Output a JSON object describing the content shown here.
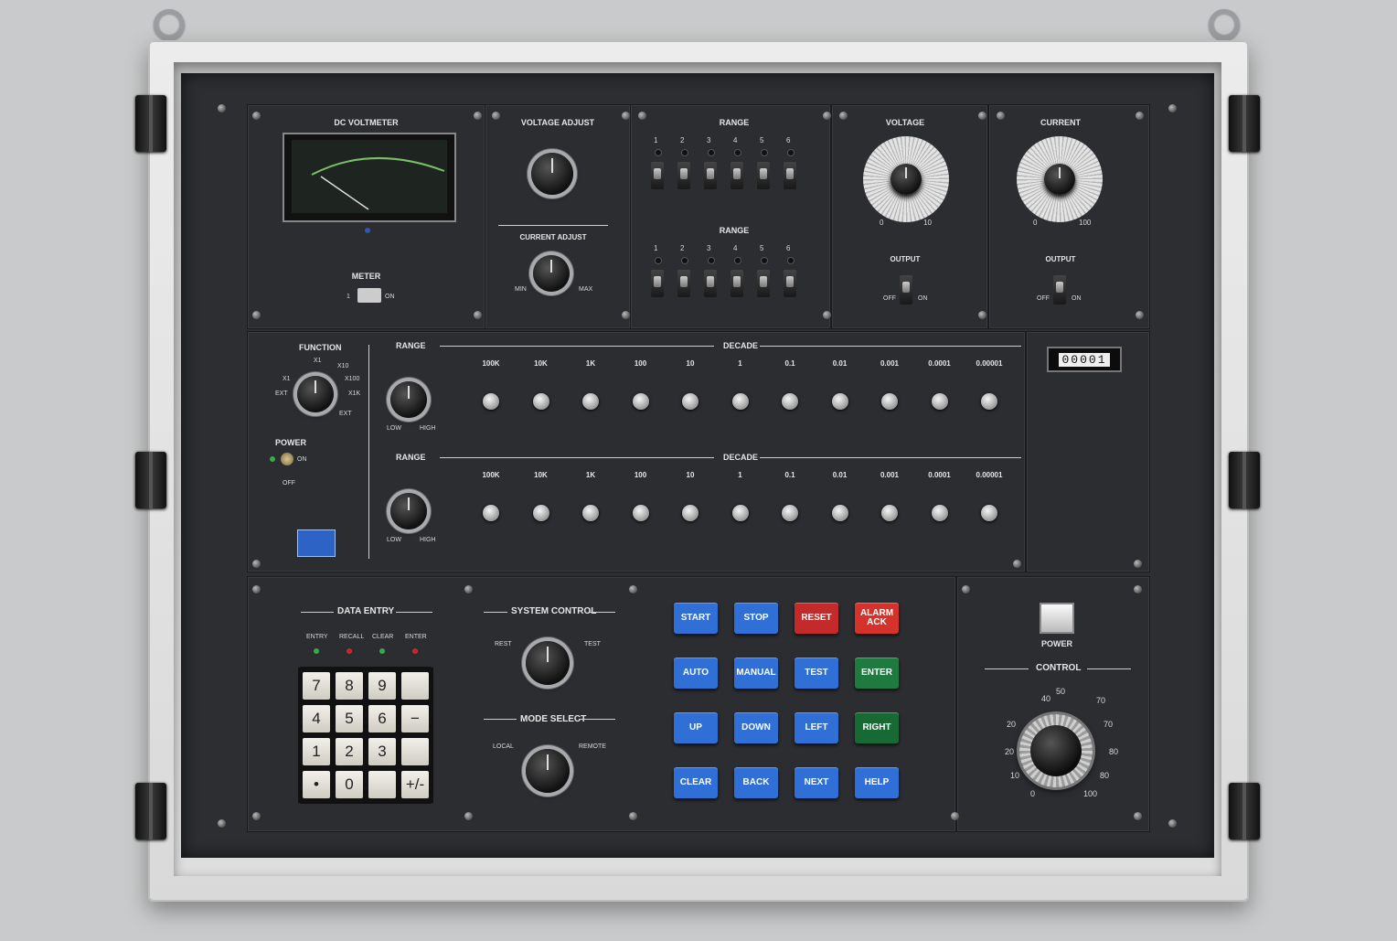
{
  "meter_panel": {
    "title": "DC VOLTMETER",
    "meter_label": "METER",
    "left": "1",
    "right": "ON"
  },
  "adjust_panel": {
    "voltage": "VOLTAGE ADJUST",
    "current": "CURRENT ADJUST",
    "min": "MIN",
    "max": "MAX"
  },
  "range_panel": {
    "title": "RANGE",
    "title2": "RANGE",
    "numbers": [
      "1",
      "2",
      "3",
      "4",
      "5",
      "6"
    ]
  },
  "voltage_panel": {
    "title": "VOLTAGE",
    "min": "0",
    "max": "10",
    "output": "OUTPUT",
    "off": "OFF",
    "on": "ON"
  },
  "current_panel": {
    "title": "CURRENT",
    "min": "0",
    "max": "100",
    "output": "OUTPUT",
    "off": "OFF",
    "on": "ON"
  },
  "function_panel": {
    "function": "FUNCTION",
    "positions": [
      "X1",
      "X1",
      "X10",
      "X100",
      "X1K",
      "EXT",
      "EXT"
    ],
    "power": "POWER",
    "on": "ON",
    "off": "OFF",
    "range": "RANGE",
    "decade": "DECADE",
    "low": "LOW",
    "high": "HIGH",
    "decades": [
      "100K",
      "10K",
      "1K",
      "100",
      "10",
      "1",
      "0.1",
      "0.01",
      "0.001",
      "0.0001",
      "0.00001"
    ]
  },
  "counter": {
    "digits": "00001"
  },
  "data_entry": {
    "title": "DATA ENTRY",
    "leds": [
      "ENTRY",
      "RECALL",
      "CLEAR",
      "ENTER"
    ],
    "keys": [
      "7",
      "8",
      "9",
      "",
      "4",
      "5",
      "6",
      "−",
      "1",
      "2",
      "3",
      "",
      "•",
      "0",
      "",
      "+/-"
    ]
  },
  "system_control": {
    "title": "SYSTEM CONTROL",
    "rest": "REST",
    "test": "TEST",
    "mode": "MODE SELECT",
    "local": "LOCAL",
    "remote": "REMOTE"
  },
  "buttons": [
    {
      "label": "START",
      "color": "#2f6fd6"
    },
    {
      "label": "STOP",
      "color": "#2f6fd6"
    },
    {
      "label": "RESET",
      "color": "#c42a2a"
    },
    {
      "label": "ALARM ACK",
      "color": "#d4322a"
    },
    {
      "label": "AUTO",
      "color": "#2f6fd6"
    },
    {
      "label": "MANUAL",
      "color": "#2f6fd6"
    },
    {
      "label": "TEST",
      "color": "#2f6fd6"
    },
    {
      "label": "ENTER",
      "color": "#1e7a3e"
    },
    {
      "label": "UP",
      "color": "#2f6fd6"
    },
    {
      "label": "DOWN",
      "color": "#2f6fd6"
    },
    {
      "label": "LEFT",
      "color": "#2f6fd6"
    },
    {
      "label": "RIGHT",
      "color": "#176a34"
    },
    {
      "label": "CLEAR",
      "color": "#2f6fd6"
    },
    {
      "label": "BACK",
      "color": "#2f6fd6"
    },
    {
      "label": "NEXT",
      "color": "#2f6fd6"
    },
    {
      "label": "HELP",
      "color": "#2f6fd6"
    }
  ],
  "control_panel": {
    "power": "POWER",
    "control": "CONTROL",
    "scale": [
      "0",
      "10",
      "20",
      "20",
      "40",
      "50",
      "70",
      "70",
      "80",
      "80",
      "100"
    ]
  }
}
